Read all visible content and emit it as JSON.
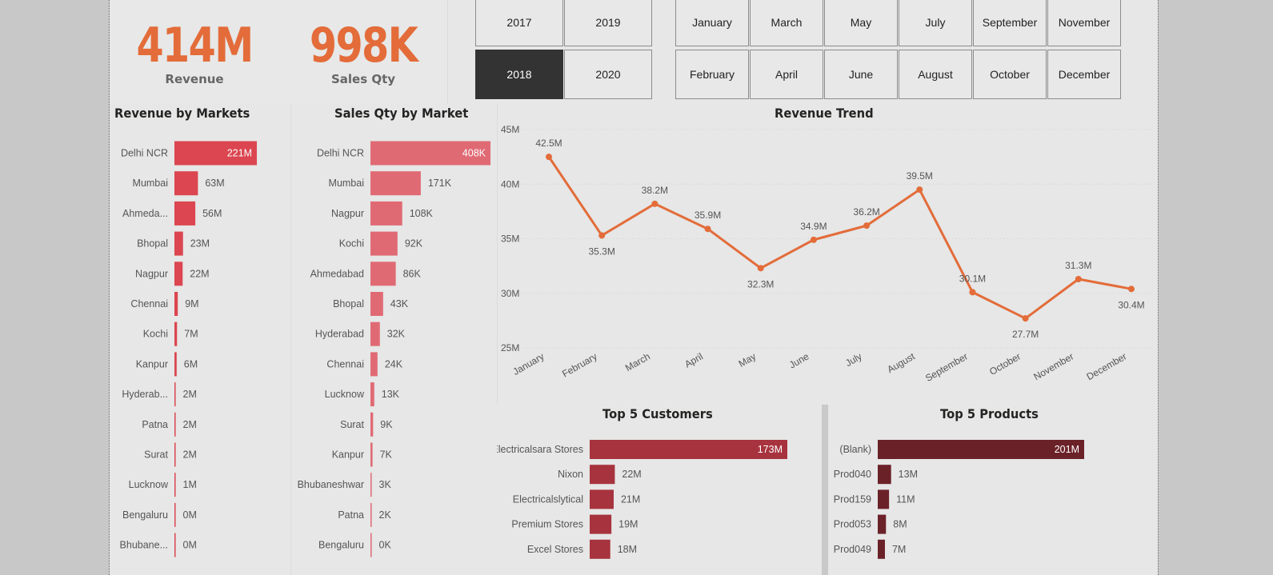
{
  "kpis": {
    "revenue": {
      "value": "414M",
      "label": "Revenue"
    },
    "sales_qty": {
      "value": "998K",
      "label": "Sales Qty"
    }
  },
  "year_slicer": {
    "options": [
      "2017",
      "2019",
      "2018",
      "2020"
    ],
    "selected": "2018"
  },
  "month_slicer": {
    "options": [
      "January",
      "March",
      "May",
      "July",
      "September",
      "November",
      "February",
      "April",
      "June",
      "August",
      "October",
      "December"
    ]
  },
  "colors": {
    "kpi": "#e36c3a",
    "revenue_bar": "#db4650",
    "qty_bar": "#e06a74",
    "trend_line": "#e36c3a",
    "customer_bar": "#a7333e",
    "product_bar": "#6b2128",
    "selected_slicer": "#333333"
  },
  "chart_data": [
    {
      "id": "revenue_by_markets",
      "type": "bar",
      "orientation": "horizontal",
      "title": "Revenue by Markets",
      "categories": [
        "Delhi NCR",
        "Mumbai",
        "Ahmeda...",
        "Bhopal",
        "Nagpur",
        "Chennai",
        "Kochi",
        "Kanpur",
        "Hyderab...",
        "Patna",
        "Surat",
        "Lucknow",
        "Bengaluru",
        "Bhubane..."
      ],
      "values": [
        221,
        63,
        56,
        23,
        22,
        9,
        7,
        6,
        2,
        2,
        2,
        1,
        0,
        0
      ],
      "labels": [
        "221M",
        "63M",
        "56M",
        "23M",
        "22M",
        "9M",
        "7M",
        "6M",
        "2M",
        "2M",
        "2M",
        "1M",
        "0M",
        "0M"
      ],
      "unit": "M"
    },
    {
      "id": "sales_qty_by_market",
      "type": "bar",
      "orientation": "horizontal",
      "title": "Sales Qty by Market",
      "categories": [
        "Delhi NCR",
        "Mumbai",
        "Nagpur",
        "Kochi",
        "Ahmedabad",
        "Bhopal",
        "Hyderabad",
        "Chennai",
        "Lucknow",
        "Surat",
        "Kanpur",
        "Bhubaneshwar",
        "Patna",
        "Bengaluru"
      ],
      "values": [
        408,
        171,
        108,
        92,
        86,
        43,
        32,
        24,
        13,
        9,
        7,
        3,
        2,
        0
      ],
      "labels": [
        "408K",
        "171K",
        "108K",
        "92K",
        "86K",
        "43K",
        "32K",
        "24K",
        "13K",
        "9K",
        "7K",
        "3K",
        "2K",
        "0K"
      ],
      "unit": "K"
    },
    {
      "id": "revenue_trend",
      "type": "line",
      "title": "Revenue Trend",
      "x": [
        "January",
        "February",
        "March",
        "April",
        "May",
        "June",
        "July",
        "August",
        "September",
        "October",
        "November",
        "December"
      ],
      "values": [
        42.5,
        35.3,
        38.2,
        35.9,
        32.3,
        34.9,
        36.2,
        39.5,
        30.1,
        27.7,
        31.3,
        30.4
      ],
      "labels": [
        "42.5M",
        "35.3M",
        "38.2M",
        "35.9M",
        "32.3M",
        "34.9M",
        "36.2M",
        "39.5M",
        "30.1M",
        "27.7M",
        "31.3M",
        "30.4M"
      ],
      "y_ticks": [
        "45M",
        "40M",
        "35M",
        "30M",
        "25M"
      ],
      "ylim": [
        25,
        45
      ],
      "grid": true
    },
    {
      "id": "top_customers",
      "type": "bar",
      "orientation": "horizontal",
      "title": "Top 5 Customers",
      "categories": [
        "Electricalsara Stores",
        "Nixon",
        "Electricalslytical",
        "Premium Stores",
        "Excel Stores"
      ],
      "values": [
        173,
        22,
        21,
        19,
        18
      ],
      "labels": [
        "173M",
        "22M",
        "21M",
        "19M",
        "18M"
      ],
      "unit": "M"
    },
    {
      "id": "top_products",
      "type": "bar",
      "orientation": "horizontal",
      "title": "Top 5 Products",
      "categories": [
        "(Blank)",
        "Prod040",
        "Prod159",
        "Prod053",
        "Prod049"
      ],
      "values": [
        201,
        13,
        11,
        8,
        7
      ],
      "labels": [
        "201M",
        "13M",
        "11M",
        "8M",
        "7M"
      ],
      "unit": "M"
    }
  ]
}
